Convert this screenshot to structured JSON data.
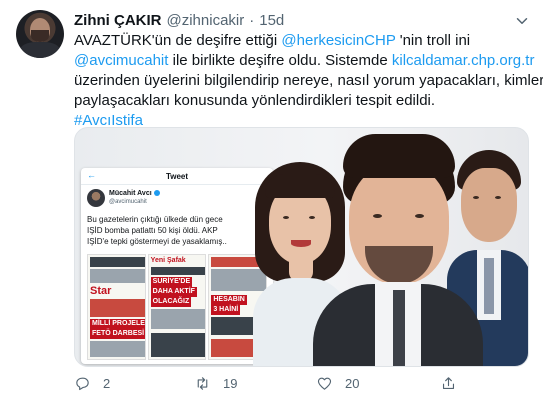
{
  "author": {
    "name": "Zihni ÇAKIR",
    "handle": "@zihnicakir",
    "separator": "·",
    "time": "15d"
  },
  "tweet_text": {
    "l1_a": "AVAZTÜRK'ün de deşifre ettiği ",
    "l1_link": "@herkesicinCHP",
    "l1_b": " 'nin troll ini",
    "l2_link": "@avcimucahit",
    "l2_a": " ile birlikte deşifre oldu. Sistemde ",
    "l2_link2": "kilcaldamar.chp.org.tr",
    "l3": "üzerinden üyelerini bilgilendirip nereye, nasıl yorum yapacakları, kimleri",
    "l4": "paylaşacakları konusunda yönlendirdikleri tespit edildi.",
    "hashtag": "#AvcıIstifa"
  },
  "embedded_tweet": {
    "title": "Tweet",
    "name": "Mücahit Avcı",
    "handle": "@avcimucahit",
    "text_lines": [
      "Bu gazetelerin çıktığı ülkede dün gece",
      "IŞİD bomba patlattı 50 kişi öldü. AKP",
      "IŞİD'e tepki göstermeyi de yasaklamış.."
    ],
    "papers": {
      "p1_mast": "Star",
      "p1_head1": "MİLLİ PROJELER",
      "p1_head2": "FETÖ DARBESİ",
      "p2_mast": "Yeni Şafak",
      "p2_head1": "SURİYE'DE",
      "p2_head2": "DAHA AKTİF",
      "p2_head3": "OLACAĞIZ",
      "p3_head1": "HESABIN",
      "p3_head2": "3 HAİNİ"
    }
  },
  "actions": {
    "reply_count": "2",
    "retweet_count": "19",
    "like_count": "20"
  },
  "icons": [
    "reply-icon",
    "retweet-icon",
    "like-icon",
    "share-icon",
    "caret-down-icon"
  ],
  "colors": {
    "link": "#1d9bf0",
    "text": "#0f1419",
    "muted": "#536471"
  }
}
